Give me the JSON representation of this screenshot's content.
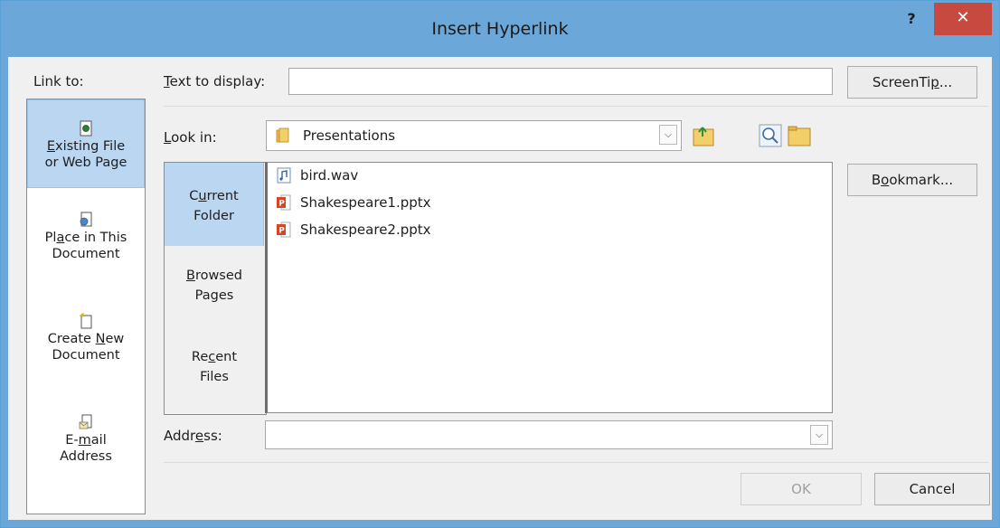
{
  "window": {
    "title": "Insert Hyperlink",
    "help_label": "?",
    "close_label": "✕",
    "accent_color": "#6ba7d9",
    "close_color": "#c7493f"
  },
  "link_to": {
    "label": "Link to:",
    "items": [
      {
        "line1_pre": "",
        "line1_u": "E",
        "line1_post": "xisting File",
        "line2": "or Web Page",
        "icon": "web-page-icon",
        "selected": true
      },
      {
        "line1_pre": "Pl",
        "line1_u": "a",
        "line1_post": "ce in This",
        "line2": "Document",
        "icon": "place-in-document-icon",
        "selected": false
      },
      {
        "line1_pre": "Create ",
        "line1_u": "N",
        "line1_post": "ew",
        "line2": "Document",
        "icon": "new-document-icon",
        "selected": false
      },
      {
        "line1_pre": "E-",
        "line1_u": "m",
        "line1_post": "ail",
        "line2": "Address",
        "icon": "email-address-icon",
        "selected": false
      }
    ]
  },
  "text_to_display": {
    "label_u": "T",
    "label_rest": "ext to display:",
    "value": ""
  },
  "screentip": {
    "pre": "ScreenTi",
    "u": "p",
    "post": "..."
  },
  "look_in": {
    "label_u": "L",
    "label_rest": "ook in:",
    "value": "Presentations"
  },
  "browse": {
    "items": [
      {
        "line1_pre": "C",
        "line1_u": "u",
        "line1_post": "rrent",
        "line2": "Folder",
        "selected": true
      },
      {
        "line1_pre": "",
        "line1_u": "B",
        "line1_post": "rowsed",
        "line2": "Pages",
        "selected": false
      },
      {
        "line1_pre": "Re",
        "line1_u": "c",
        "line1_post": "ent",
        "line2": "Files",
        "selected": false
      }
    ]
  },
  "files": [
    {
      "name": "bird.wav",
      "icon": "audio-file-icon"
    },
    {
      "name": "Shakespeare1.pptx",
      "icon": "powerpoint-file-icon"
    },
    {
      "name": "Shakespeare2.pptx",
      "icon": "powerpoint-file-icon"
    }
  ],
  "bookmark": {
    "pre": "B",
    "u": "o",
    "post": "okmark..."
  },
  "address": {
    "label_pre": "Addr",
    "label_u": "e",
    "label_post": "ss:",
    "value": ""
  },
  "ok_label": "OK",
  "cancel_label": "Cancel"
}
